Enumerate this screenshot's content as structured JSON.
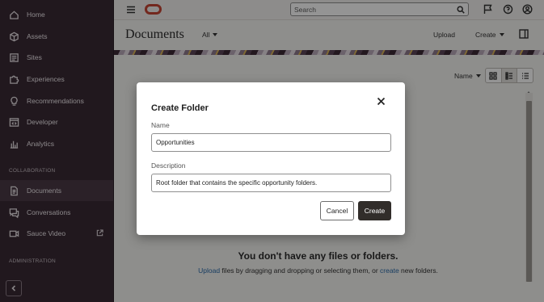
{
  "sidebar": {
    "items": [
      {
        "label": "Home",
        "icon": "home-icon"
      },
      {
        "label": "Assets",
        "icon": "cube-icon"
      },
      {
        "label": "Sites",
        "icon": "sites-icon"
      },
      {
        "label": "Experiences",
        "icon": "puzzle-icon"
      },
      {
        "label": "Recommendations",
        "icon": "lightbulb-icon"
      },
      {
        "label": "Developer",
        "icon": "code-icon"
      },
      {
        "label": "Analytics",
        "icon": "bar-chart-icon"
      },
      {
        "label": "Documents",
        "icon": "documents-icon",
        "active": true
      },
      {
        "label": "Conversations",
        "icon": "chat-icon"
      },
      {
        "label": "Sauce Video",
        "icon": "video-icon"
      }
    ],
    "sections": {
      "collaboration": "COLLABORATION",
      "administration": "ADMINISTRATION"
    }
  },
  "topbar": {
    "search_placeholder": "Search"
  },
  "header": {
    "title": "Documents",
    "filter": "All",
    "upload": "Upload",
    "create": "Create"
  },
  "content": {
    "sort": "Name",
    "empty_title": "You don't have any files or folders.",
    "empty_link_upload": "Upload",
    "empty_text_1": " files by dragging and dropping or selecting them, or ",
    "empty_link_create": "create",
    "empty_text_2": " new folders."
  },
  "dialog": {
    "title": "Create Folder",
    "name_label": "Name",
    "name_value": "Opportunities",
    "description_label": "Description",
    "description_value": "Root folder that contains the specific opportunity folders.",
    "cancel": "Cancel",
    "create": "Create"
  },
  "colors": {
    "sidebar_bg": "#3a2a35",
    "brand_red": "#c74634",
    "primary_button": "#312d2a",
    "link": "#2a6aa8"
  }
}
